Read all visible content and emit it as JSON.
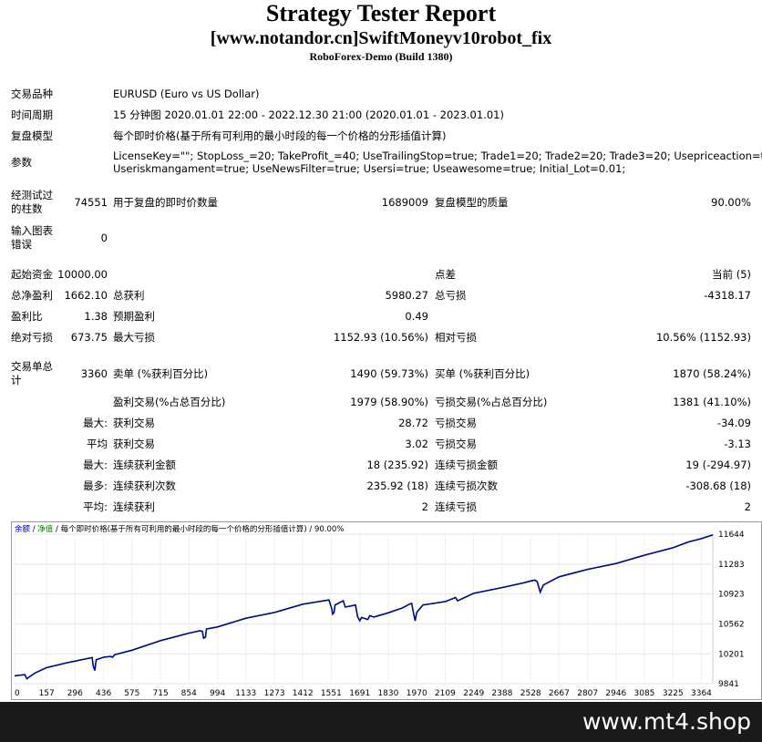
{
  "header": {
    "title": "Strategy Tester Report",
    "subtitle": "[www.notandor.cn]SwiftMoneyv10robot_fix",
    "server": "RoboForex-Demo (Build 1380)"
  },
  "settings": {
    "symbol_label": "交易品种",
    "symbol_value": "EURUSD (Euro vs US Dollar)",
    "period_label": "时间周期",
    "period_value": "15 分钟图 2020.01.01 22:00 - 2022.12.30 21:00 (2020.01.01 - 2023.01.01)",
    "model_label": "复盘模型",
    "model_value": "每个即时价格(基于所有可利用的最小时段的每一个价格的分形插值计算)",
    "params_label": "参数",
    "params_line1": "LicenseKey=\"\"; StopLoss_=20; TakeProfit_=40; UseTrailingStop=true; Trade1=20; Trade2=20; Trade3=20; Usepriceaction=true;",
    "params_line2": "Useriskmangament=true; UseNewsFilter=true; Usersi=true; Useawesome=true; Initial_Lot=0.01;"
  },
  "bars": {
    "bars_label": "经测试过的柱数",
    "bars_value": "74551",
    "ticks_label": "用于复盘的即时价数量",
    "ticks_value": "1689009",
    "quality_label": "复盘模型的质量",
    "quality_value": "90.00%",
    "errors_label": "输入图表错误",
    "errors_value": "0"
  },
  "results": {
    "deposit_label": "起始资金",
    "deposit_value": "10000.00",
    "spread_label": "点差",
    "spread_value": "当前 (5)",
    "net_label": "总净盈利",
    "net_value": "1662.10",
    "gross_profit_label": "总获利",
    "gross_profit_value": "5980.27",
    "gross_loss_label": "总亏损",
    "gross_loss_value": "-4318.17",
    "pf_label": "盈利比",
    "pf_value": "1.38",
    "payoff_label": "预期盈利",
    "payoff_value": "0.49",
    "abs_dd_label": "绝对亏损",
    "abs_dd_value": "673.75",
    "max_dd_label": "最大亏损",
    "max_dd_value": "1152.93 (10.56%)",
    "rel_dd_label": "相对亏损",
    "rel_dd_value": "10.56% (1152.93)",
    "trades_label": "交易单总计",
    "trades_value": "3360",
    "short_label": "卖单 (%获利百分比)",
    "short_value": "1490 (59.73%)",
    "long_label": "买单 (%获利百分比)",
    "long_value": "1870 (58.24%)",
    "profit_trades_label": "盈利交易(%占总百分比)",
    "profit_trades_value": "1979 (58.90%)",
    "loss_trades_label": "亏损交易(%占总百分比)",
    "loss_trades_value": "1381 (41.10%)",
    "max_prefix": "最大:",
    "largest_profit_label": "获利交易",
    "largest_profit_value": "28.72",
    "largest_loss_label": "亏损交易",
    "largest_loss_value": "-34.09",
    "avg_prefix": "平均",
    "avg_profit_label": "获利交易",
    "avg_profit_value": "3.02",
    "avg_loss_label": "亏损交易",
    "avg_loss_value": "-3.13",
    "max2_prefix": "最大:",
    "cons_wins_amt_label": "连续获利金额",
    "cons_wins_amt_value": "18 (235.92)",
    "cons_losses_amt_label": "连续亏损金额",
    "cons_losses_amt_value": "19 (-294.97)",
    "most_prefix": "最多:",
    "cons_profit_label": "连续获利次数",
    "cons_profit_value": "235.92 (18)",
    "cons_loss_label": "连续亏损次数",
    "cons_loss_value": "-308.68 (18)",
    "avg2_prefix": "平均:",
    "avg_cons_wins_label": "连续获利",
    "avg_cons_wins_value": "2",
    "avg_cons_losses_label": "连续亏损",
    "avg_cons_losses_value": "2"
  },
  "chart_data": {
    "type": "line",
    "legend_balance": "余额",
    "legend_sep": " / ",
    "legend_equity": "净值",
    "legend_rest": " / 每个即时价格(基于所有可利用的最小时段的每一个价格的分形插值计算) / 90.00%",
    "x_ticks": [
      0,
      157,
      296,
      436,
      575,
      715,
      854,
      994,
      1133,
      1273,
      1412,
      1551,
      1691,
      1830,
      1970,
      2109,
      2249,
      2388,
      2528,
      2667,
      2807,
      2946,
      3085,
      3225,
      3364
    ],
    "y_ticks": [
      9841,
      10201,
      10562,
      10923,
      11283,
      11644
    ],
    "xlim": [
      0,
      3420
    ],
    "ylim": [
      9841,
      11644
    ],
    "grid": true,
    "colors": {
      "balance": "#0000a0",
      "equity": "#1a7a1a",
      "legend_balance": "#0000cc",
      "legend_equity": "#008000"
    },
    "series": [
      {
        "x": [
          0,
          50,
          60,
          100,
          157,
          250,
          360,
          380,
          385,
          393,
          400,
          436,
          470,
          480,
          490,
          575,
          715,
          854,
          910,
          920,
          926,
          935,
          940,
          994,
          1133,
          1273,
          1412,
          1540,
          1553,
          1558,
          1565,
          1570,
          1610,
          1620,
          1670,
          1680,
          1691,
          1700,
          1730,
          1740,
          1760,
          1830,
          1900,
          1930,
          1945,
          1956,
          1962,
          1970,
          2000,
          2109,
          2160,
          2170,
          2249,
          2388,
          2500,
          2528,
          2550,
          2560,
          2575,
          2590,
          2667,
          2807,
          2946,
          3085,
          3225,
          3300,
          3364,
          3420
        ],
        "y": [
          9935,
          9950,
          9900,
          9970,
          10035,
          10090,
          10145,
          10155,
          10060,
          10000,
          10130,
          10160,
          10170,
          10160,
          10190,
          10245,
          10360,
          10450,
          10480,
          10470,
          10390,
          10400,
          10500,
          10525,
          10630,
          10700,
          10800,
          10850,
          10750,
          10680,
          10700,
          10790,
          10840,
          10765,
          10790,
          10650,
          10600,
          10640,
          10615,
          10660,
          10645,
          10695,
          10755,
          10795,
          10810,
          10670,
          10600,
          10700,
          10790,
          10830,
          10880,
          10840,
          10930,
          11000,
          11060,
          11080,
          11090,
          11070,
          10945,
          11030,
          11130,
          11220,
          11290,
          11390,
          11480,
          11550,
          11590,
          11635
        ]
      }
    ]
  },
  "footer": {
    "watermark": "www.mt4.shop"
  }
}
